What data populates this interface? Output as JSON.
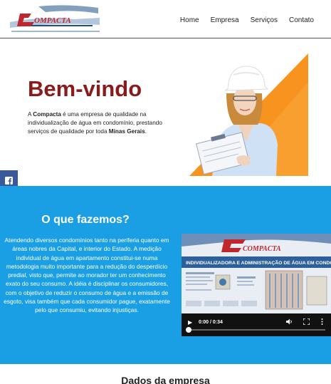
{
  "header": {
    "logo_text": "COMPACTA",
    "nav": [
      "Home",
      "Empresa",
      "Serviços",
      "Contato"
    ]
  },
  "hero": {
    "title": "Bem-vindo",
    "text_prefix": "A ",
    "brand": "Compacta",
    "text_middle": " é uma empresa de qualidade na individualização de água em condomínio, prestando serviços de qualidade por toda ",
    "region": "Minas Gerais",
    "text_suffix": "."
  },
  "social": {
    "facebook_icon": "facebook-icon",
    "instagram_icon": "instagram-icon"
  },
  "about": {
    "title": "O que fazemos?",
    "text": "Atendendo diversos condomínios tanto na periferia quanto em áreas nobres da Capital, e interior do Estado. A medição individual de água em apartamento constitui-se numa metodologia muito importante para a redução do desperdício predial, visto que, permite ao morador ter um conhecimento exato do seu consumo. A idéia é disciplinar os consumidores, com o objetivo de reduzir o consumo de água e a emissão de esgoto, visa também que cada consumidor pague, exatamente pelo que consumiu, evitando injustiças."
  },
  "video": {
    "banner_logo": "COMPACTA",
    "banner_text": "INDIVIDUALIZADORA E ADMINISTRAÇÃO DE ÁGUA EM CONDOMÍNIO",
    "time": "0:00 / 0:34",
    "progress": 0.0
  },
  "next_section": {
    "title": "Dados da empresa"
  },
  "colors": {
    "accent": "#1a9fe4",
    "title_red": "#8b1a1a",
    "orange": "#f7931e"
  }
}
